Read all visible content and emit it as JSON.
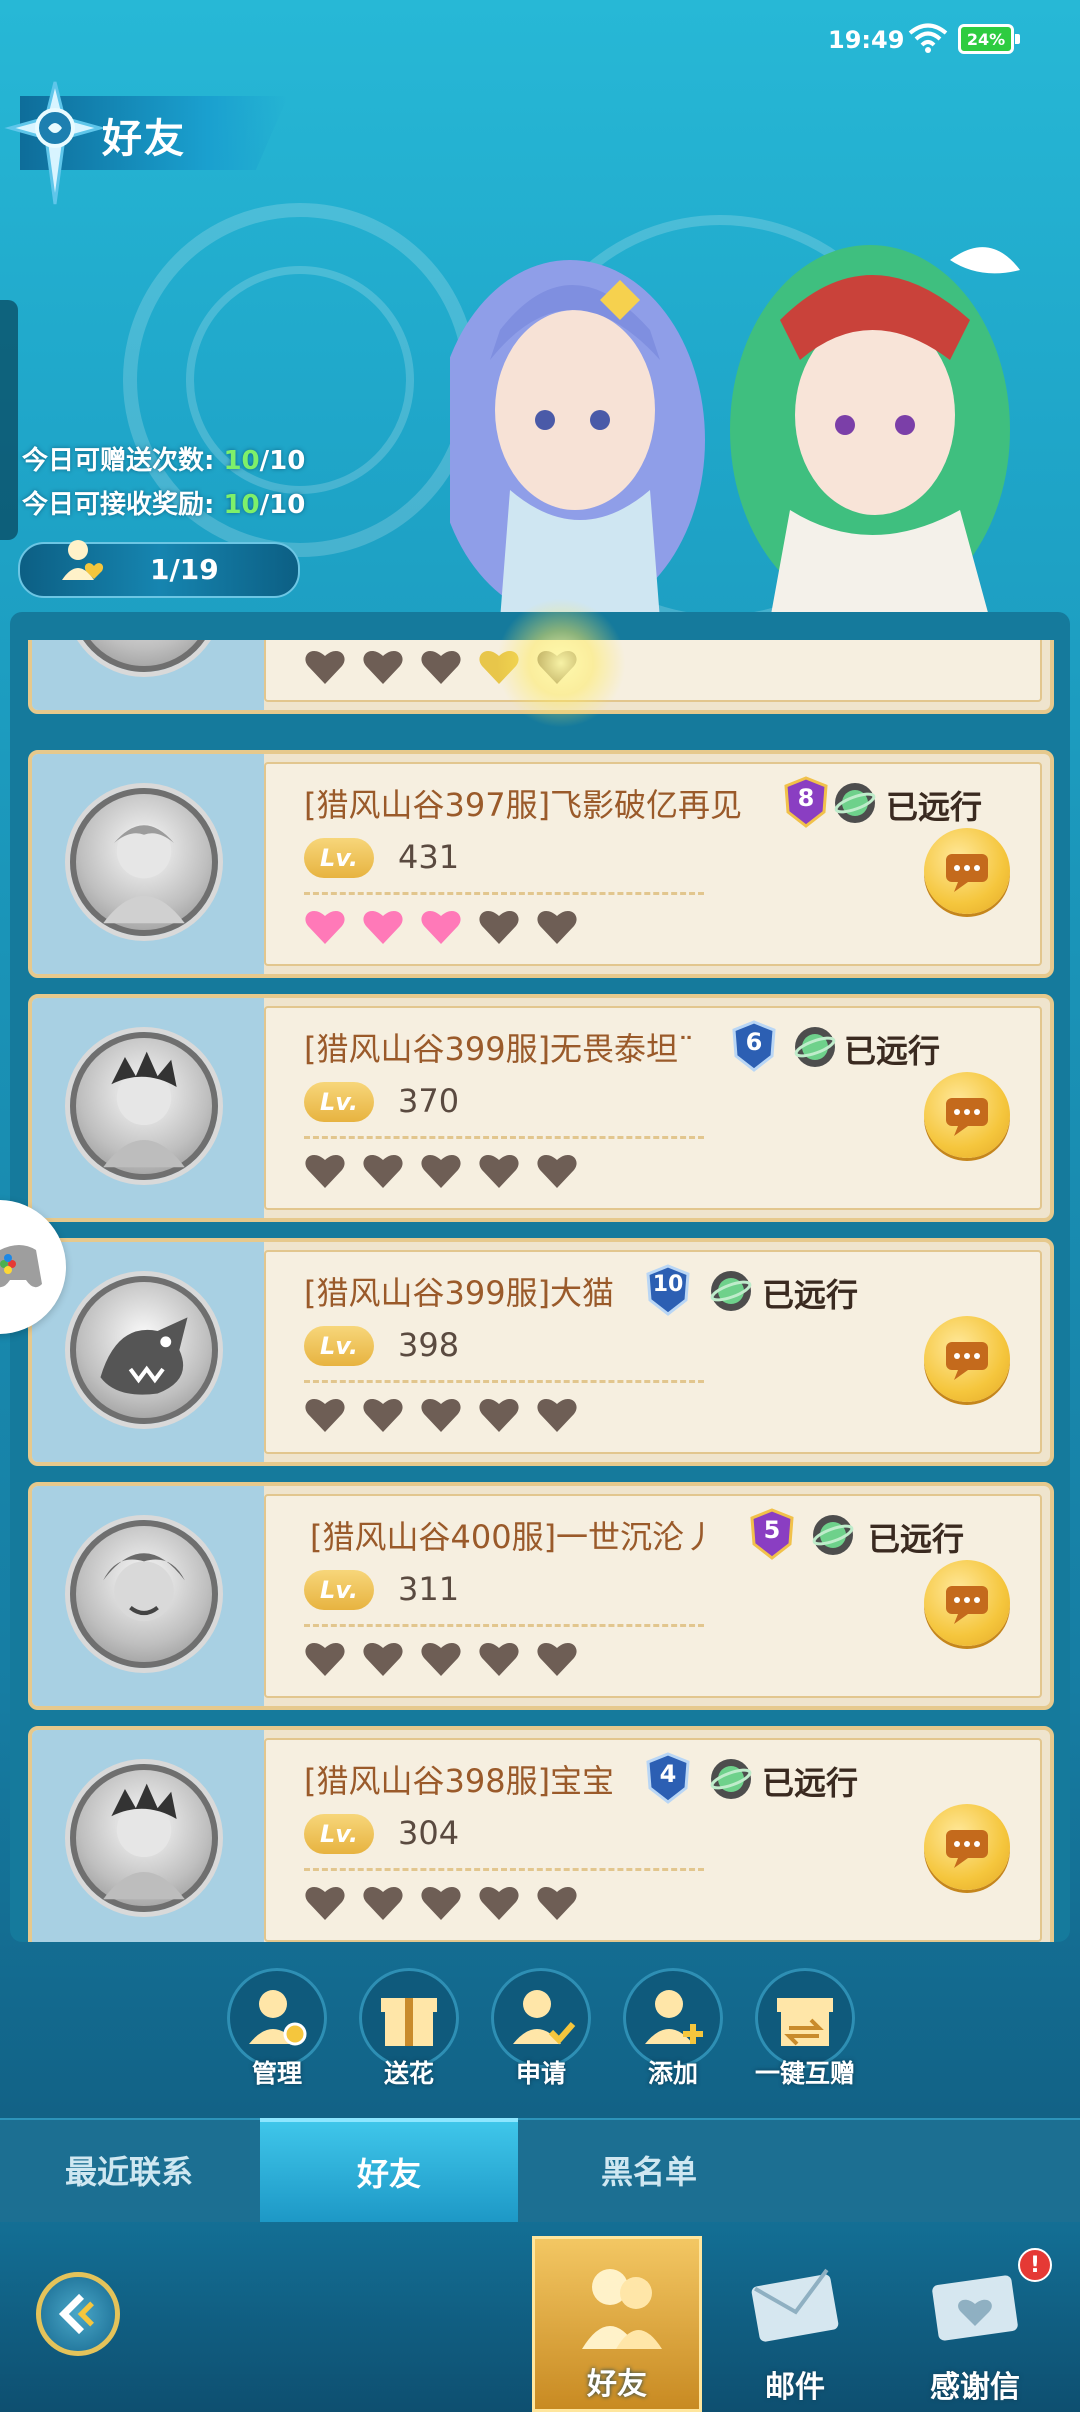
{
  "status_bar": {
    "time": "19:49",
    "battery": "24%"
  },
  "header": {
    "title": "好友"
  },
  "stats": {
    "send_label": "今日可赠送次数:",
    "send_used": "10",
    "send_total": "/10",
    "receive_label": "今日可接收奖励:",
    "receive_used": "10",
    "receive_total": "/10",
    "friend_count": "1/19"
  },
  "friends": [
    {
      "name": "[猎风山谷397服]飞影破亿再见",
      "rank": "8",
      "status": "已远行",
      "level": "431",
      "hearts_filled": 3
    },
    {
      "name": "[猎风山谷399服]无畏泰坦¨",
      "rank": "6",
      "status": "已远行",
      "level": "370",
      "hearts_filled": 0
    },
    {
      "name": "[猎风山谷399服]大猫",
      "rank": "10",
      "status": "已远行",
      "level": "398",
      "hearts_filled": 0
    },
    {
      "name": "[猎风山谷400服]一世沉沦丿",
      "rank": "5",
      "status": "已远行",
      "level": "311",
      "hearts_filled": 0
    },
    {
      "name": "[猎风山谷398服]宝宝",
      "rank": "4",
      "status": "已远行",
      "level": "304",
      "hearts_filled": 0
    }
  ],
  "lv_label": "Lv.",
  "actions": [
    "管理",
    "送花",
    "申请",
    "添加",
    "一键互赠"
  ],
  "tabs": {
    "recent": "最近联系",
    "friends": "好友",
    "blacklist": "黑名单"
  },
  "bottom_nav": {
    "friends": "好友",
    "mail": "邮件",
    "thanks": "感谢信",
    "thanks_badge": "!"
  },
  "colors": {
    "accent_gold": "#f5c63d",
    "heart_pink": "#ff79b8",
    "heart_empty": "#6e5e55",
    "highlight_green": "#7ef06a"
  }
}
